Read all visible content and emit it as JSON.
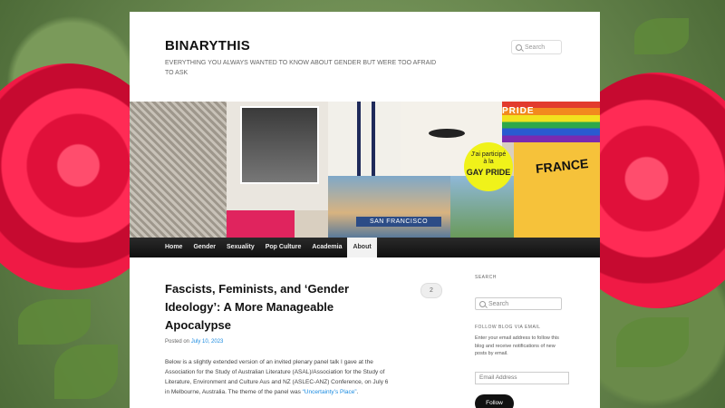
{
  "site": {
    "title": "BINARYTHIS",
    "tagline": "EVERYTHING YOU ALWAYS WANTED TO KNOW ABOUT GENDER BUT WERE TOO AFRAID TO ASK"
  },
  "header_search": {
    "placeholder": "Search"
  },
  "header_image": {
    "badge_line1": "J'ai participé",
    "badge_line2": "à la",
    "badge_line3": "GAY PRIDE",
    "sf_label": "SAN FRANCISCO",
    "pride_label": "PRIDE",
    "france_label": "FRANCE"
  },
  "nav": {
    "items": [
      {
        "label": "Home"
      },
      {
        "label": "Gender"
      },
      {
        "label": "Sexuality"
      },
      {
        "label": "Pop Culture"
      },
      {
        "label": "Academia"
      },
      {
        "label": "About"
      }
    ]
  },
  "article": {
    "title": "Fascists, Feminists, and ‘Gender Ideology’: A More Manageable Apocalypse",
    "comment_count": "2",
    "posted_prefix": "Posted on ",
    "posted_date": "July 10, 2023",
    "body_main": "Below is a slightly extended version of an invited plenary panel talk I gave at the Association for the Study of Australian Literature (ASAL)/Association for the Study of Literature, Environment and Culture Aus and NZ (ASLEC-ANZ) Conference, on July 6 in Melbourne, Australia. The theme of the panel was ",
    "body_link": "“Uncertainty’s Place”",
    "body_end": "."
  },
  "sidebar": {
    "search_label": "SEARCH",
    "search_placeholder": "Search",
    "follow_label": "FOLLOW BLOG VIA EMAIL",
    "follow_text": "Enter your email address to follow this blog and receive notifications of new posts by email.",
    "email_placeholder": "Email Address",
    "follow_button": "Follow"
  },
  "colors": {
    "accent_link": "#1b8be0",
    "nav_bg": "#1a1a1a",
    "badge_yellow": "#f0f21a",
    "rose_red": "#e0103a"
  }
}
